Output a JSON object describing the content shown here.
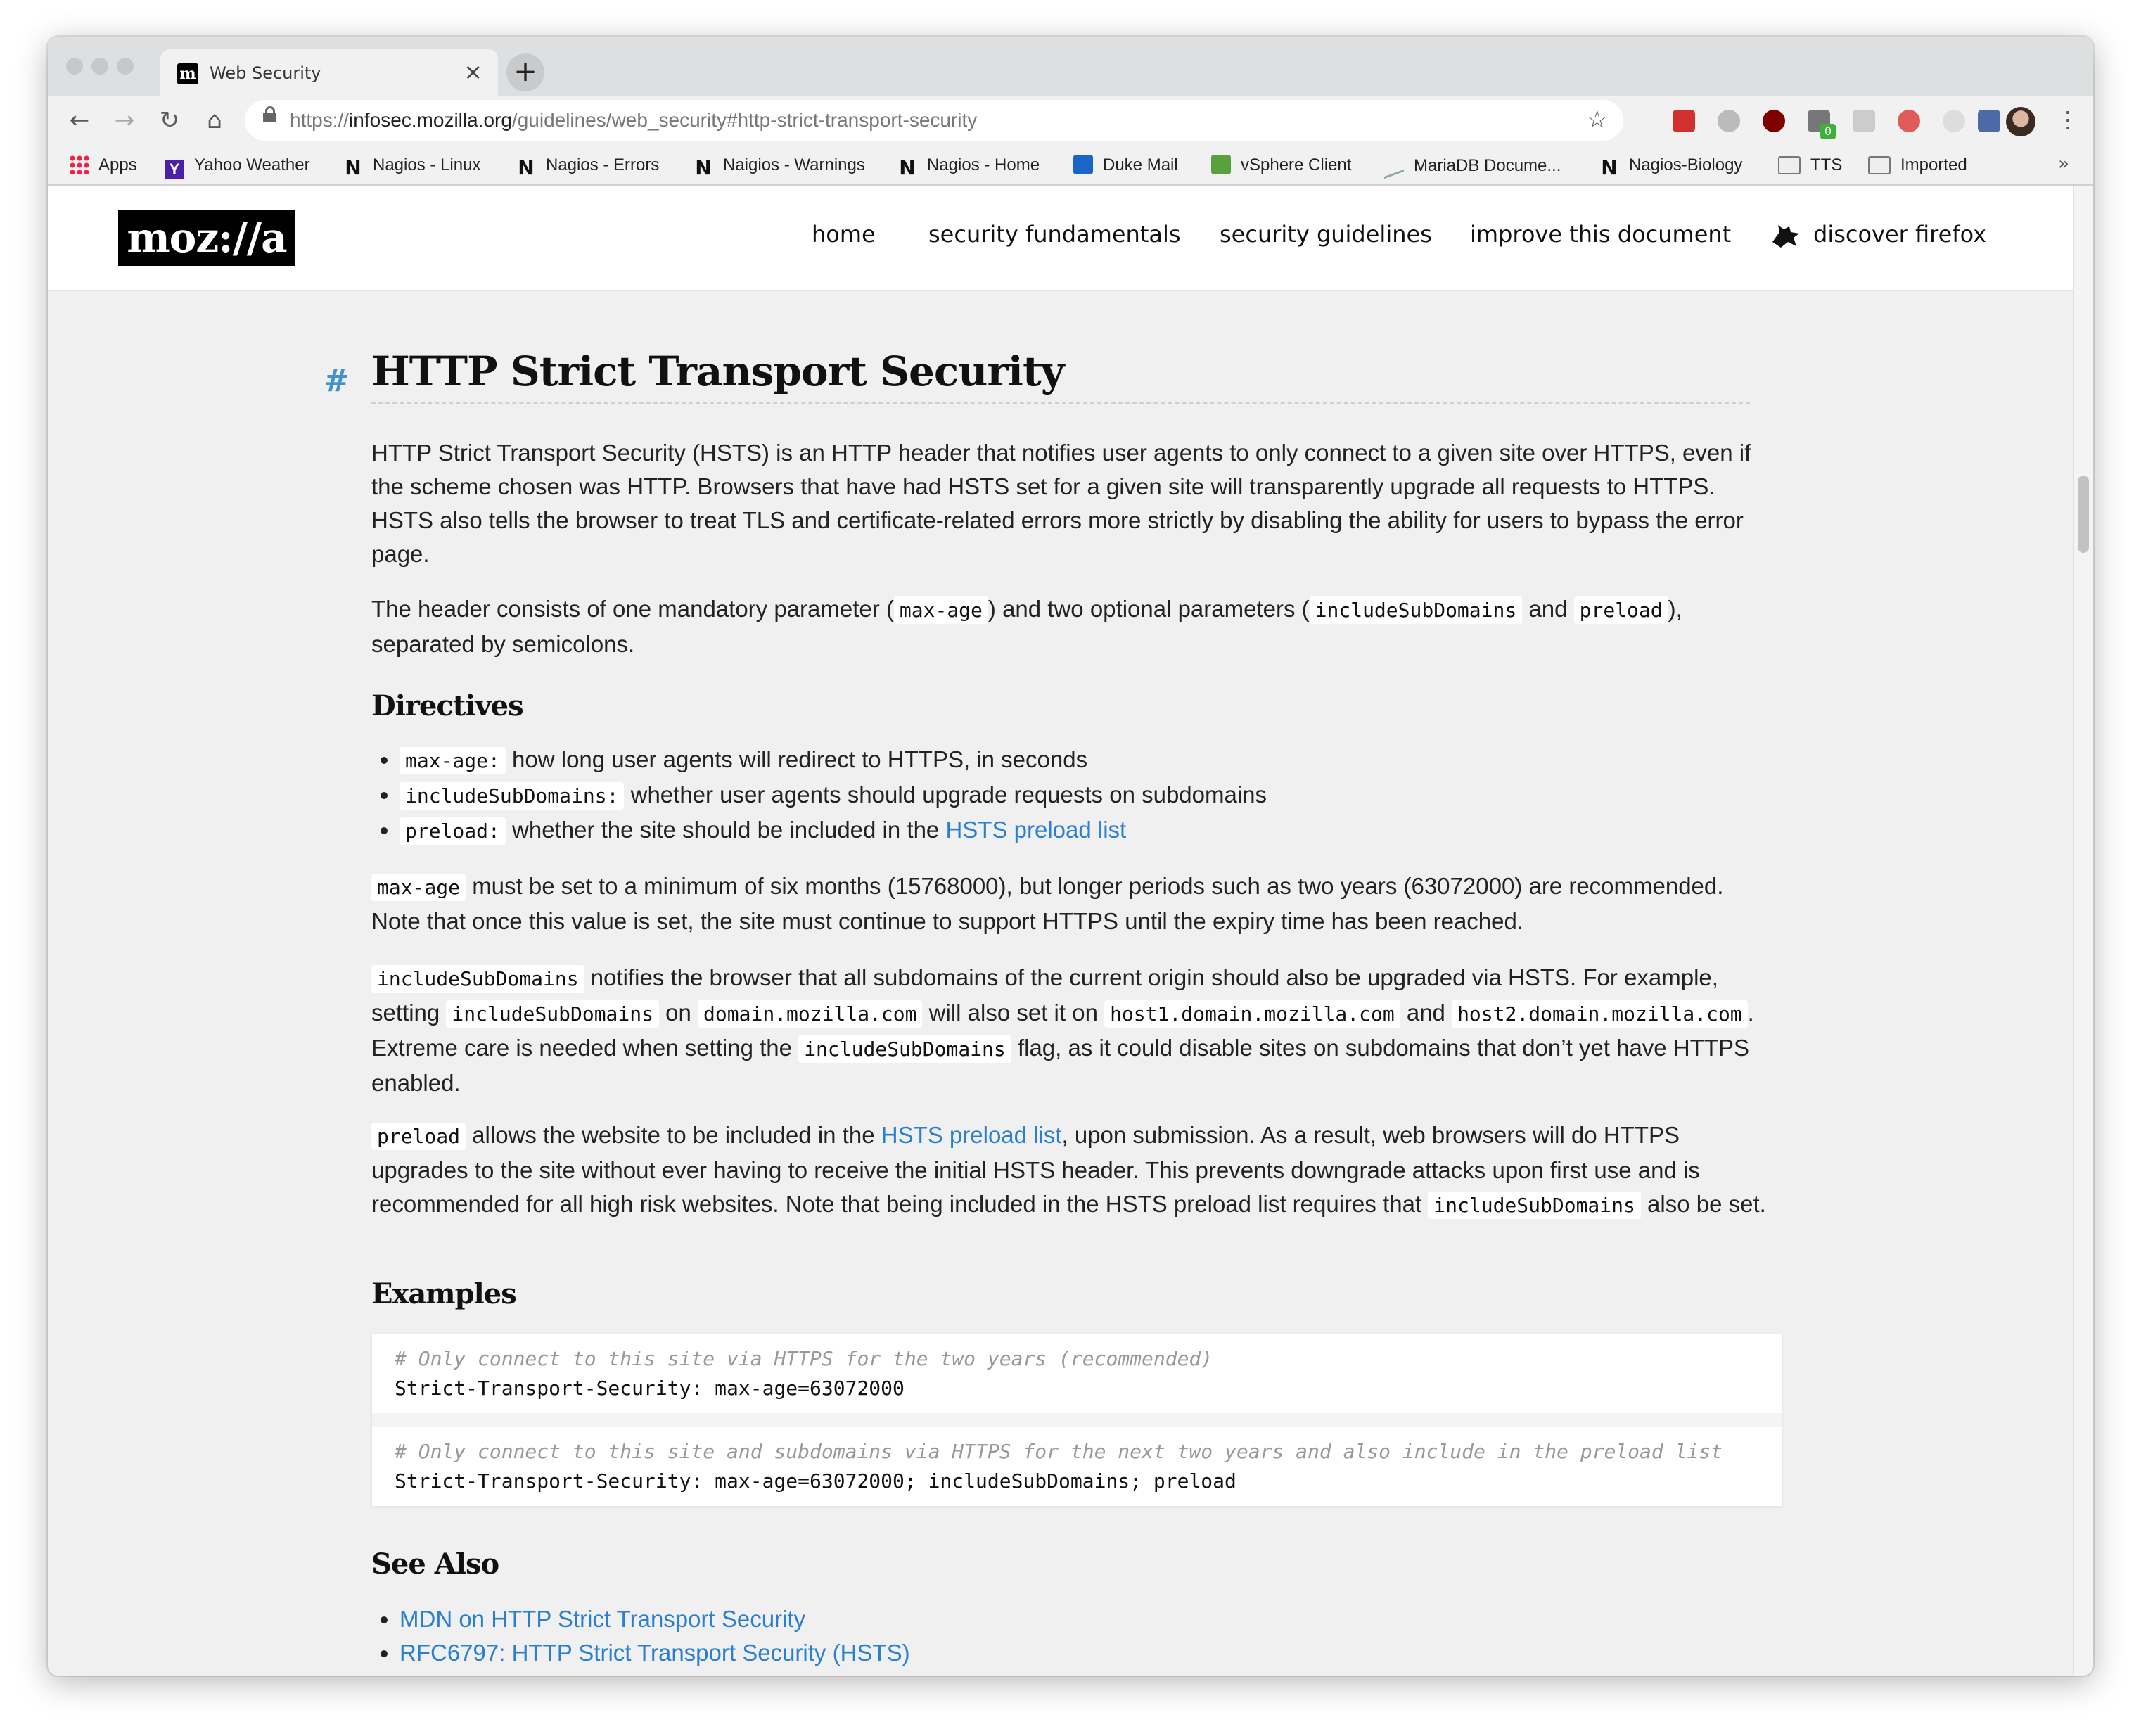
{
  "browser": {
    "tab": {
      "title": "Web Security",
      "favicon": "m"
    },
    "new_tab": "+",
    "url": {
      "scheme": "https://",
      "host": "infosec.mozilla.org",
      "path": "/guidelines/web_security#http-strict-transport-security"
    },
    "bookmarks": [
      {
        "label": "Apps",
        "icon": "apps-grid-icon"
      },
      {
        "label": "Yahoo Weather",
        "icon": "yahoo-icon"
      },
      {
        "label": "Nagios - Linux",
        "icon": "nagios-icon"
      },
      {
        "label": "Nagios - Errors",
        "icon": "nagios-icon"
      },
      {
        "label": "Naigios - Warnings",
        "icon": "nagios-icon"
      },
      {
        "label": "Nagios - Home",
        "icon": "nagios-icon"
      },
      {
        "label": "Duke Mail",
        "icon": "outlook-icon"
      },
      {
        "label": "vSphere Client",
        "icon": "vsphere-icon"
      },
      {
        "label": "MariaDB Docume...",
        "icon": "mariadb-icon"
      },
      {
        "label": "Nagios-Biology",
        "icon": "nagios-icon"
      },
      {
        "label": "TTS",
        "icon": "folder-icon"
      },
      {
        "label": "Imported",
        "icon": "folder-icon"
      }
    ],
    "bookmarks_more": "»",
    "extension_badge": "0"
  },
  "site": {
    "logo": "moz://a",
    "nav": [
      "home",
      "security fundamentals",
      "security guidelines",
      "improve this document",
      "discover firefox"
    ]
  },
  "article": {
    "anchor": "#",
    "title": "HTTP Strict Transport Security",
    "intro": "HTTP Strict Transport Security (HSTS) is an HTTP header that notifies user agents to only connect to a given site over HTTPS, even if the scheme chosen was HTTP. Browsers that have had HSTS set for a given site will transparently upgrade all requests to HTTPS. HSTS also tells the browser to treat TLS and certificate-related errors more strictly by disabling the ability for users to bypass the error page.",
    "header_para": {
      "t1": "The header consists of one mandatory parameter (",
      "c1": "max-age",
      "t2": ") and two optional parameters (",
      "c2": "includeSubDomains",
      "t3": "and",
      "c3": "preload",
      "t4": "), separated by semicolons."
    },
    "directives_heading": "Directives",
    "directives": [
      {
        "code": "max-age:",
        "text": "how long user agents will redirect to HTTPS, in seconds"
      },
      {
        "code": "includeSubDomains:",
        "text": "whether user agents should upgrade requests on subdomains"
      },
      {
        "code": "preload:",
        "text": "whether the site should be included in the",
        "link": "HSTS preload list"
      }
    ],
    "maxage_para": {
      "c1": "max-age",
      "t1": "must be set to a minimum of six months (15768000), but longer periods such as two years (63072000) are recommended. Note that once this value is set, the site must continue to support HTTPS until the expiry time has been reached."
    },
    "isd_para": {
      "c1": "includeSubDomains",
      "t1": "notifies the browser that all subdomains of the current origin should also be upgraded via HSTS. For example, setting",
      "c2": "includeSubDomains",
      "t2": "on",
      "c3": "domain.mozilla.com",
      "t3": "will also set it on",
      "c4": "host1.domain.mozilla.com",
      "t4": "and",
      "c5": "host2.domain.mozilla.com",
      "t5": ". Extreme care is needed when setting the",
      "c6": "includeSubDomains",
      "t6": "flag, as it could disable sites on subdomains that don’t yet have HTTPS enabled."
    },
    "preload_para": {
      "c1": "preload",
      "t1": "allows the website to be included in the",
      "link": "HSTS preload list",
      "t2": ", upon submission. As a result, web browsers will do HTTPS upgrades to the site without ever having to receive the initial HSTS header. This prevents downgrade attacks upon first use and is recommended for all high risk websites. Note that being included in the HSTS preload list requires that",
      "c2": "includeSubDomains",
      "t3": "also be set."
    },
    "examples_heading": "Examples",
    "examples": [
      {
        "comment": "# Only connect to this site via HTTPS for the two years (recommended)",
        "line": "Strict-Transport-Security: max-age=63072000"
      },
      {
        "comment": "# Only connect to this site and subdomains via HTTPS for the next two years and also include in the preload list",
        "line": "Strict-Transport-Security: max-age=63072000; includeSubDomains; preload"
      }
    ],
    "see_also_heading": "See Also",
    "see_also": [
      "MDN on HTTP Strict Transport Security",
      "RFC6797: HTTP Strict Transport Security (HSTS)"
    ]
  }
}
